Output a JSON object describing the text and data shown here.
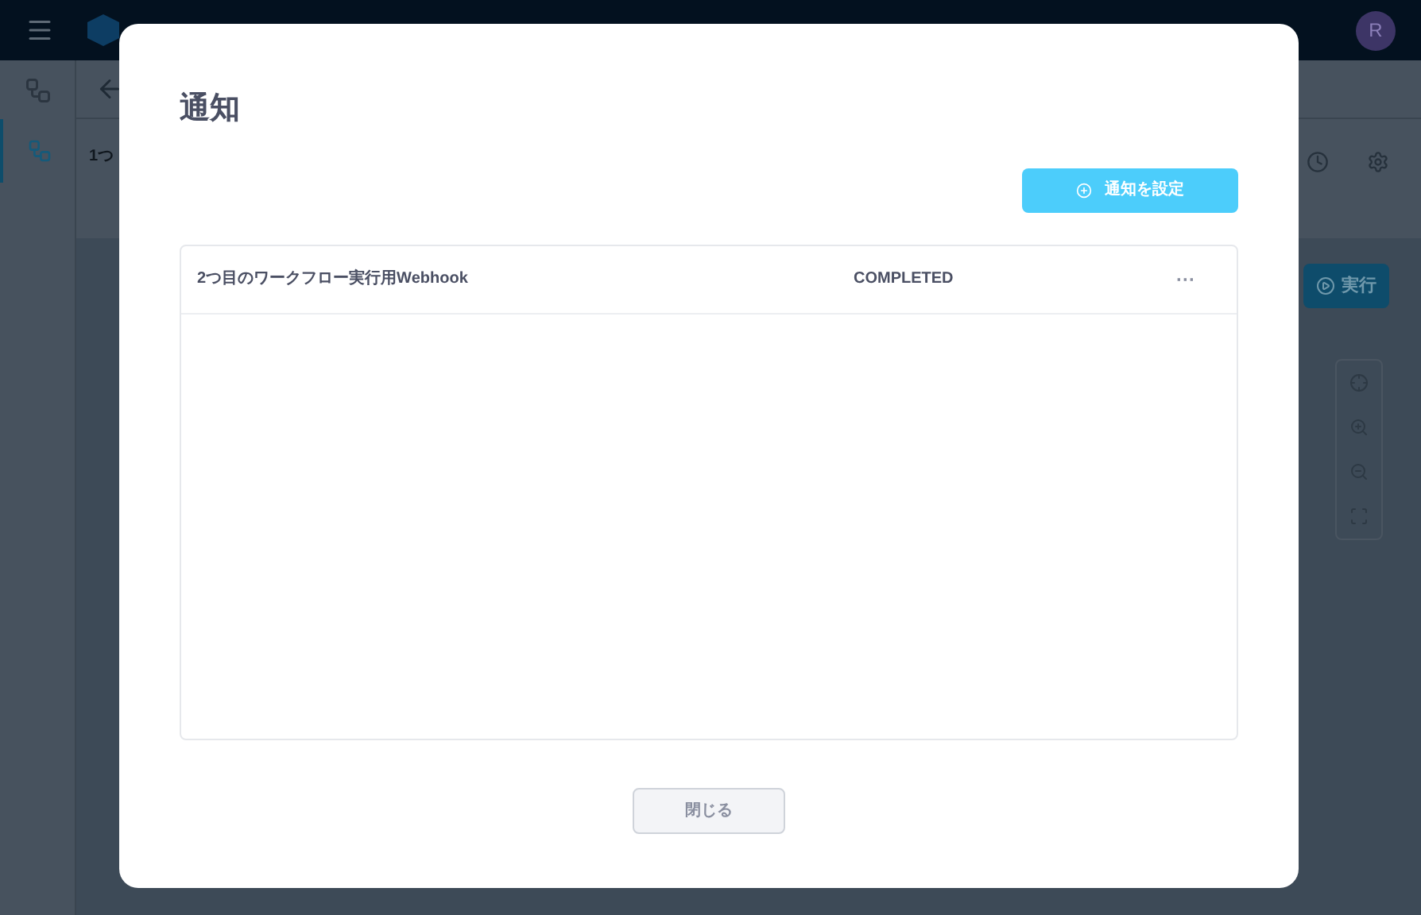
{
  "background": {
    "avatar": "R",
    "workflow_title": "1つ",
    "run_button": "実行"
  },
  "dialog": {
    "title": "通知",
    "add_button": "通知を設定",
    "notifications": [
      {
        "name": "2つ目のワークフロー実行用Webhook",
        "status": "COMPLETED",
        "menu": "···"
      }
    ],
    "close_button": "閉じる"
  }
}
